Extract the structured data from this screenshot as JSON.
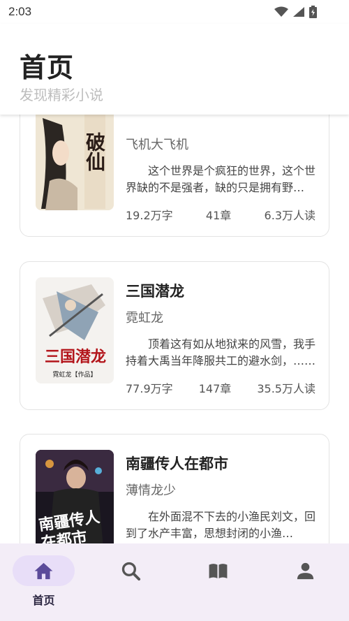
{
  "status_bar": {
    "time": "2:03"
  },
  "header": {
    "title": "首页",
    "subtitle": "发现精彩小说"
  },
  "books": [
    {
      "title": "",
      "author": "飞机大飞机",
      "description": "这个世界是个疯狂的世界，这个世界缺的不是强者，缺的只是拥有野心的人……",
      "word_count": "19.2万字",
      "chapters": "41章",
      "readers": "6.3万人读",
      "cover_text": "破仙"
    },
    {
      "title": "三国潜龙",
      "author": "霓虹龙",
      "description": "顶着这有如从地狱来的风雪，我手持着大禹当年降服共工的避水剑，……",
      "word_count": "77.9万字",
      "chapters": "147章",
      "readers": "35.5万人读",
      "cover_text": "三国潜龙",
      "cover_caption": "霓虹龙【作品】"
    },
    {
      "title": "南疆传人在都市",
      "author": "薄情龙少",
      "description": "在外面混不下去的小渔民刘文，回到了水产丰富，思想封闭的小渔村。……",
      "cover_text": "南疆传人在都市"
    }
  ],
  "bottom_nav": [
    {
      "label": "首页",
      "icon": "home-icon",
      "active": true
    },
    {
      "label": "",
      "icon": "search-icon",
      "active": false
    },
    {
      "label": "",
      "icon": "book-icon",
      "active": false
    },
    {
      "label": "",
      "icon": "person-icon",
      "active": false
    }
  ],
  "colors": {
    "active_pill": "#e8def8",
    "active_icon": "#5b4b9a",
    "nav_bg": "#f3edf7",
    "icon_gray": "#555555"
  }
}
